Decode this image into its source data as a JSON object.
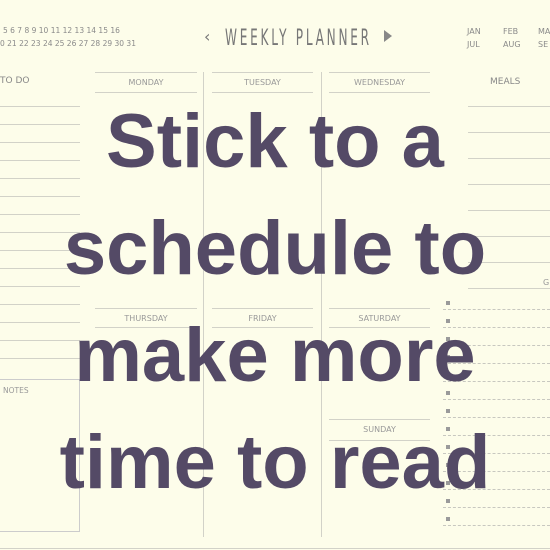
{
  "calendar": {
    "row1": "5   6   7   8   9   10   11   12   13   14   15   16",
    "row2": "0  21  22  23  24  25  26  27  28  29  30  31"
  },
  "header": {
    "title": "WEEKLY PLANNER",
    "prev_icon": "chevron-left-icon",
    "next_icon": "triangle-right-icon"
  },
  "months": {
    "row1": [
      "JAN",
      "FEB",
      "MA"
    ],
    "row2": [
      "JUL",
      "AUG",
      "SE"
    ]
  },
  "sections": {
    "todo": "TO DO",
    "notes": "NOTES",
    "meals": "MEALS",
    "right_bottom": "G"
  },
  "days": [
    "MONDAY",
    "TUESDAY",
    "WEDNESDAY",
    "THURSDAY",
    "FRIDAY",
    "SATURDAY",
    "SUNDAY"
  ],
  "overlay": {
    "lines": [
      "Stick to a",
      "schedule to",
      "make more",
      "time to read"
    ]
  },
  "colors": {
    "background": "#fdfdea",
    "overlay_text": "#544a66",
    "planner_lines": "#d2d2c8"
  }
}
